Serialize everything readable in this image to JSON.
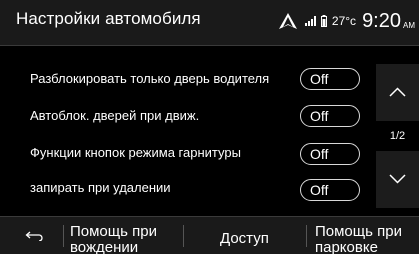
{
  "header": {
    "title": "Настройки автомобиля",
    "temperature": "27°c",
    "time": "9:20",
    "ampm": "AM"
  },
  "settings": [
    {
      "label": "Разблокировать только дверь водителя",
      "value": "Off"
    },
    {
      "label": "Автоблок. дверей при движ.",
      "value": "Off"
    },
    {
      "label": "Функции кнопок режима гарнитуры",
      "value": "Off"
    },
    {
      "label": "запирать при удалении",
      "value": "Off"
    }
  ],
  "pager": {
    "indicator": "1/2"
  },
  "bottom_bar": {
    "driving_help": "Помощь при вождении",
    "access": "Доступ",
    "parking_help": "Помощь при парковке"
  },
  "icons": {
    "nav": "navigation-arrow-icon",
    "signal": "signal-strength-icon",
    "battery": "battery-icon",
    "back": "back-arrow-icon",
    "up": "chevron-up-icon",
    "down": "chevron-down-icon"
  }
}
